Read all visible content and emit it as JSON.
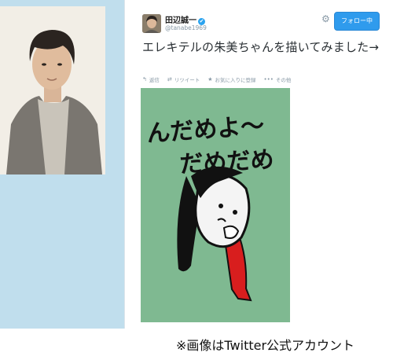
{
  "profile": {
    "display_name": "田辺誠一",
    "screen_name": "@tanabe1969",
    "verified_icon": "✔",
    "gear_icon": "⚙"
  },
  "follow_button": {
    "label": "フォロー中"
  },
  "tweet": {
    "text": "エレキテルの朱美ちゃんを描いてみました→"
  },
  "actions": [
    {
      "icon": "↰",
      "label": "返信"
    },
    {
      "icon": "⇄",
      "label": "リツイート"
    },
    {
      "icon": "★",
      "label": "お気に入りに登録"
    },
    {
      "icon": "•••",
      "label": "その他"
    }
  ],
  "drawing": {
    "text_line1": "んだめよ〜",
    "text_line2": "だめだめ",
    "background_color": "#7fb991"
  },
  "caption": "※画像はTwitter公式アカウント",
  "colors": {
    "page_background": "#c0deed",
    "follow_button": "#2f9bed",
    "link_blue": "#2aa3ef"
  }
}
